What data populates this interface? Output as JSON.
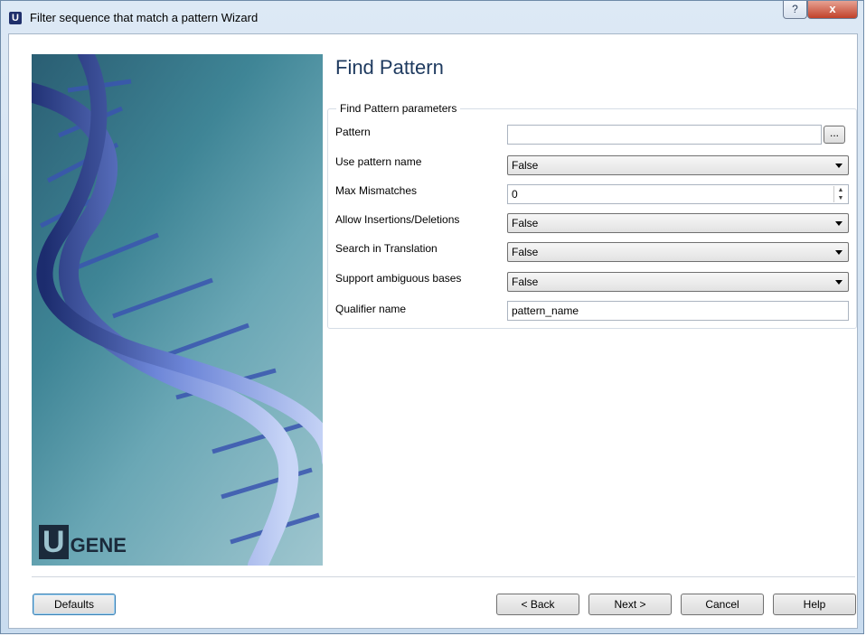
{
  "window": {
    "app_icon": "U",
    "title": "Filter sequence that match a pattern Wizard",
    "help_glyph": "?",
    "close_glyph": "x"
  },
  "banner": {
    "logo_u": "U",
    "logo_text": "GENE"
  },
  "page": {
    "title": "Find Pattern",
    "group_title": "Find Pattern parameters"
  },
  "params": {
    "pattern": {
      "label": "Pattern",
      "value": "",
      "browse_label": "..."
    },
    "use_pattern_name": {
      "label": "Use pattern name",
      "value": "False"
    },
    "max_mismatches": {
      "label": "Max Mismatches",
      "value": "0"
    },
    "allow_indels": {
      "label": "Allow Insertions/Deletions",
      "value": "False"
    },
    "search_translation": {
      "label": "Search in Translation",
      "value": "False"
    },
    "support_ambiguous": {
      "label": "Support ambiguous bases",
      "value": "False"
    },
    "qualifier_name": {
      "label": "Qualifier name",
      "value": "pattern_name"
    }
  },
  "buttons": {
    "defaults": "Defaults",
    "back": "< Back",
    "next": "Next >",
    "cancel": "Cancel",
    "help": "Help"
  }
}
